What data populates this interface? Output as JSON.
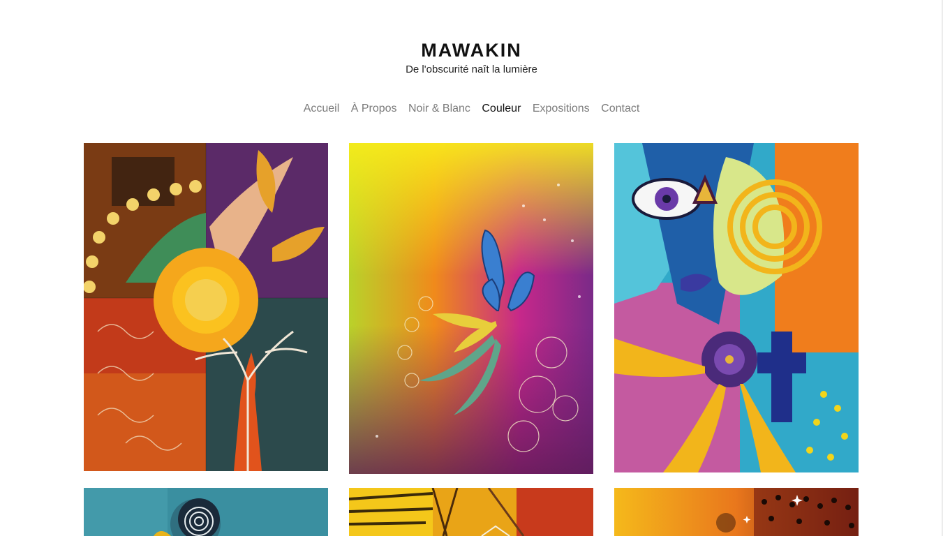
{
  "site": {
    "title": "MAWAKIN",
    "tagline": "De l'obscurité naît la lumière"
  },
  "nav": {
    "items": [
      {
        "label": "Accueil",
        "active": false
      },
      {
        "label": "À Propos",
        "active": false
      },
      {
        "label": "Noir & Blanc",
        "active": false
      },
      {
        "label": "Couleur",
        "active": true
      },
      {
        "label": "Expositions",
        "active": false
      },
      {
        "label": "Contact",
        "active": false
      }
    ]
  },
  "gallery": {
    "artworks": [
      {
        "name": "artwork-sun-tree-painting",
        "palette": [
          "#c8451c",
          "#e7a02b",
          "#2f4f52"
        ]
      },
      {
        "name": "artwork-rainbow-flower-painting",
        "palette": [
          "#e8d21e",
          "#c4247a",
          "#7b2d8a"
        ]
      },
      {
        "name": "artwork-blue-face-painting",
        "palette": [
          "#2aa5c6",
          "#f1b91f",
          "#3b2a7a"
        ]
      },
      {
        "name": "artwork-teal-spiral-painting",
        "palette": [
          "#3a8fa0"
        ]
      },
      {
        "name": "artwork-golden-lines-painting",
        "palette": [
          "#e9a417"
        ]
      },
      {
        "name": "artwork-sunset-dots-painting",
        "palette": [
          "#e98a1f"
        ]
      }
    ]
  }
}
